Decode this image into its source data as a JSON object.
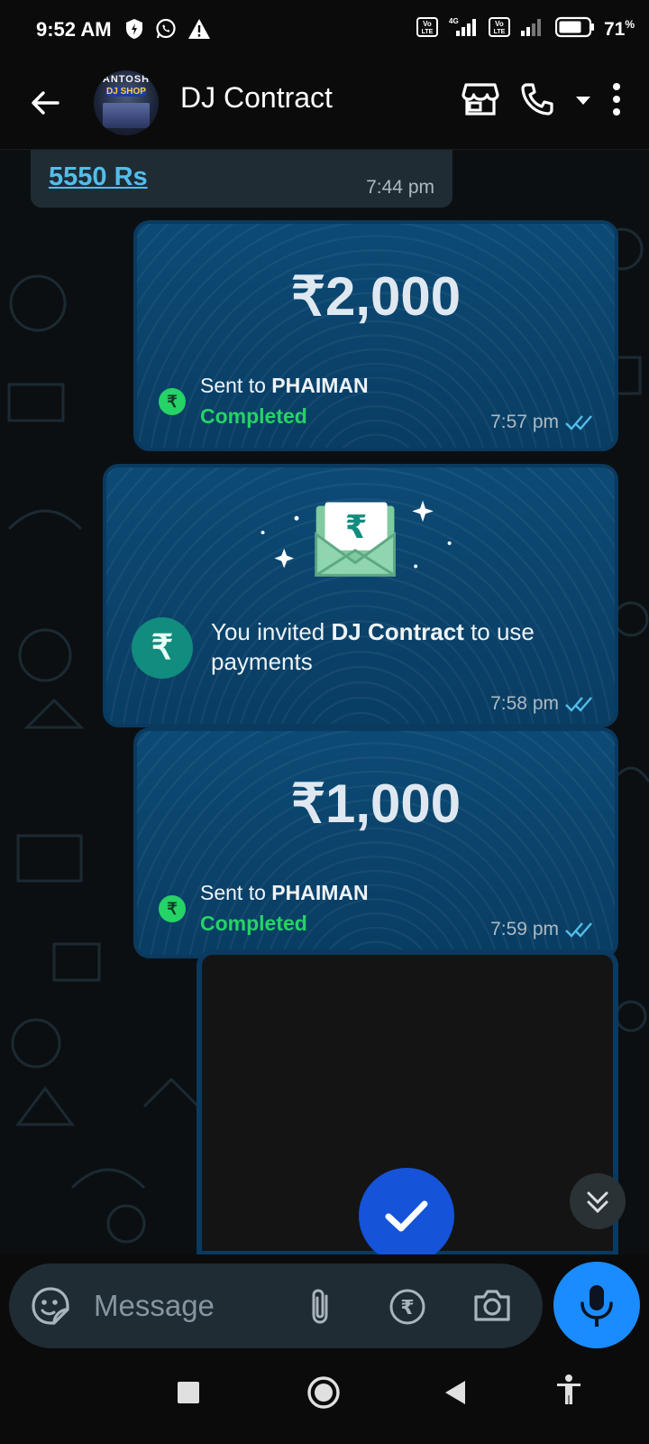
{
  "status_bar": {
    "time": "9:52 AM",
    "battery": "71",
    "battery_unit": "%",
    "left_icons": [
      "data-saver-icon",
      "whatsapp-icon",
      "warning-icon"
    ],
    "right_icons": [
      "volte-sim1-icon",
      "signal-sim1-icon",
      "volte-sim2-icon",
      "signal-sim2-icon",
      "battery-icon"
    ]
  },
  "header": {
    "title": "DJ Contract",
    "avatar_text_top": "ANTOSH",
    "avatar_text_mid": "DJ SHOP"
  },
  "messages": {
    "incoming_link": {
      "text": "5550 Rs",
      "time": "7:44 pm"
    },
    "payment_1": {
      "amount": "₹2,000",
      "sent_prefix": "Sent to ",
      "recipient": "PHAIMAN",
      "status": "Completed",
      "time": "7:57 pm"
    },
    "invite": {
      "prefix": "You invited ",
      "contact": "DJ Contract",
      "suffix": " to use payments",
      "time": "7:58 pm",
      "rupee_symbol": "₹"
    },
    "payment_2": {
      "amount": "₹1,000",
      "sent_prefix": "Sent to ",
      "recipient": "PHAIMAN",
      "status": "Completed",
      "time": "7:59 pm"
    }
  },
  "composer": {
    "placeholder": "Message"
  },
  "colors": {
    "accent_blue": "#1a8cff",
    "read_tick": "#53bdeb",
    "completed_green": "#25d366",
    "card_bg": "#0c4a75"
  }
}
